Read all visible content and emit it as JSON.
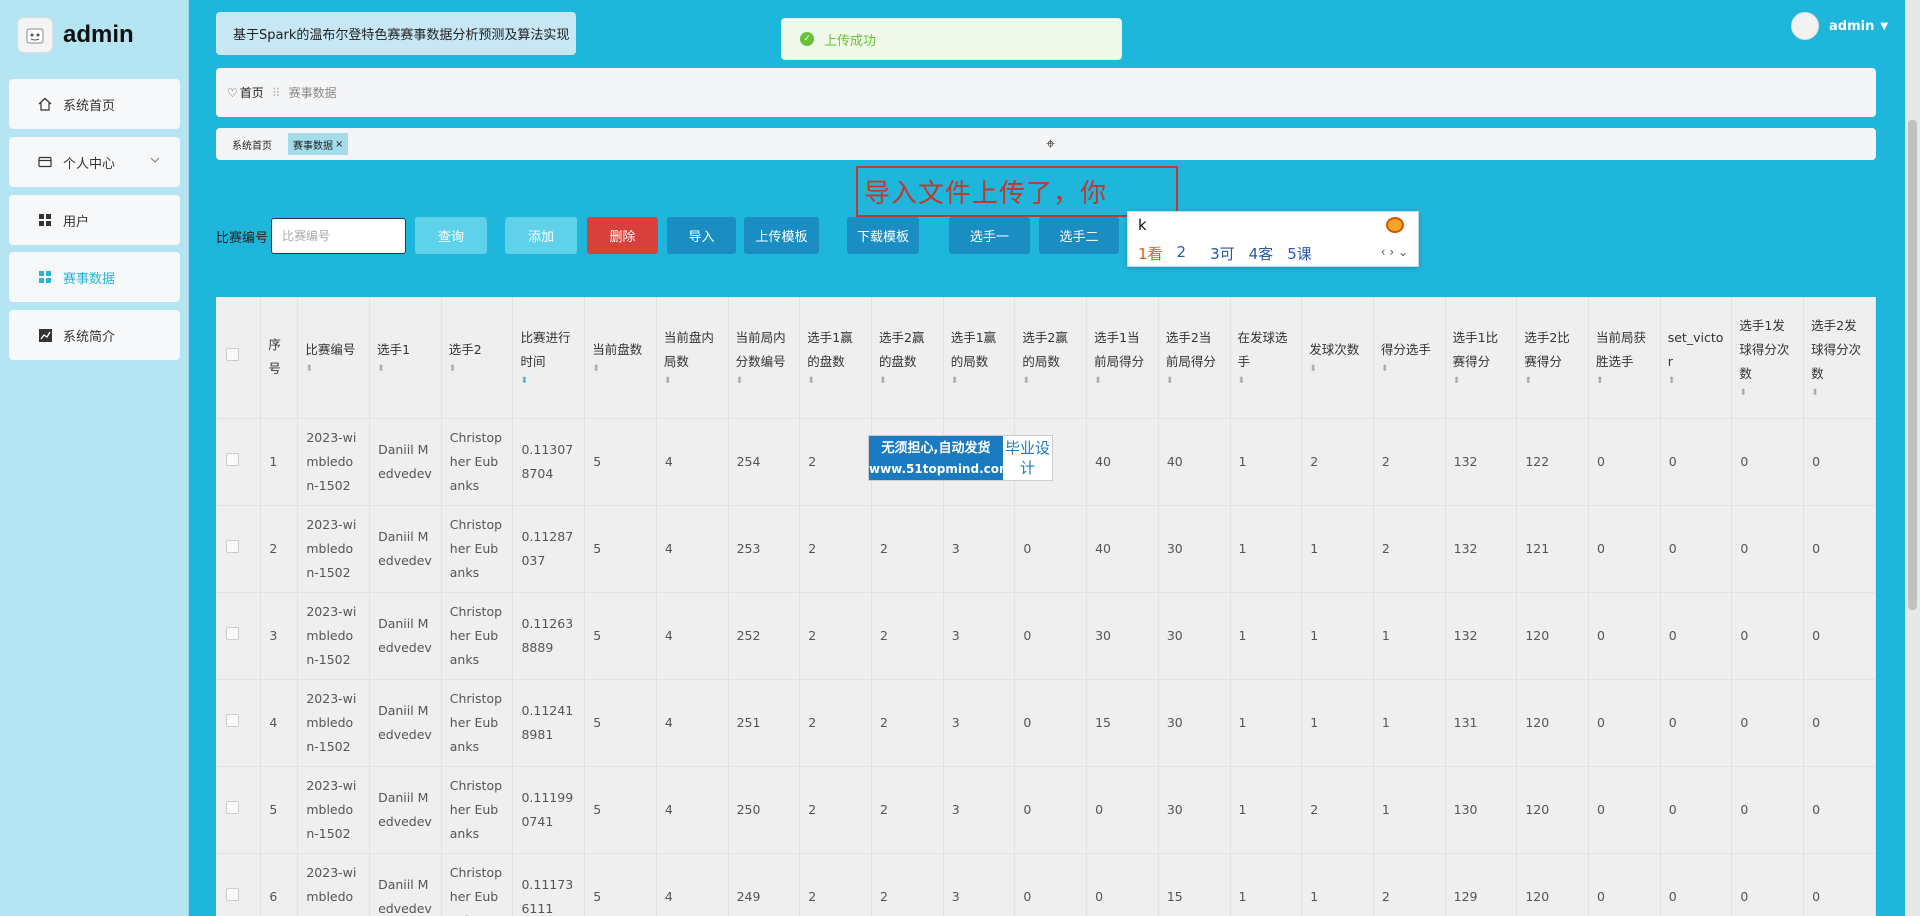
{
  "app": {
    "logo_text": "admin",
    "title": "基于Spark的温布尔登特色赛赛事数据分析预测及算法实现"
  },
  "toast": {
    "text": "上传成功"
  },
  "user": {
    "name": "admin"
  },
  "sidebar": {
    "items": [
      {
        "label": "系统首页",
        "icon": "home-icon"
      },
      {
        "label": "个人中心",
        "icon": "card-icon"
      },
      {
        "label": "用户",
        "icon": "grid-icon"
      },
      {
        "label": "赛事数据",
        "icon": "grid-icon"
      },
      {
        "label": "系统简介",
        "icon": "chart-icon"
      }
    ]
  },
  "breadcrumb": {
    "home": "首页",
    "current": "赛事数据"
  },
  "tabs": [
    {
      "label": "系统首页"
    },
    {
      "label": "赛事数据"
    }
  ],
  "annotation": "导入文件上传了，你",
  "ime": {
    "composition": "k",
    "candidates": [
      "1看",
      "2",
      "3可",
      "4客",
      "5课"
    ]
  },
  "search": {
    "label": "比赛编号",
    "placeholder": "比赛编号"
  },
  "toolbar": {
    "query": "查询",
    "add": "添加",
    "delete": "删除",
    "import": "导入",
    "upload_template": "上传模板",
    "download_template": "下载模板",
    "player1": "选手一",
    "player2": "选手二"
  },
  "watermark": {
    "line1": "无须担心,自动发货",
    "url": "www.51topmind.com",
    "right": "毕业设计"
  },
  "table": {
    "columns": [
      "序号",
      "比赛编号",
      "选手1",
      "选手2",
      "比赛进行时间",
      "当前盘数",
      "当前盘内局数",
      "当前局内分数编号",
      "选手1赢的盘数",
      "选手2赢的盘数",
      "选手1赢的局数",
      "选手2赢的局数",
      "选手1当前局得分",
      "选手2当前局得分",
      "在发球选手",
      "发球次数",
      "得分选手",
      "选手1比赛得分",
      "选手2比赛得分",
      "当前局获胜选手",
      "set_victor",
      "选手1发球得分次数",
      "选手2发球得分次数"
    ],
    "rows": [
      [
        "1",
        "2023-wimbledon-1502",
        "Daniil Medvedev",
        "Christopher Eubanks",
        "0.113078704",
        "5",
        "4",
        "254",
        "2",
        "",
        "",
        "",
        "40",
        "40",
        "1",
        "2",
        "2",
        "132",
        "122",
        "0",
        "0",
        "0",
        "0"
      ],
      [
        "2",
        "2023-wimbledon-1502",
        "Daniil Medvedev",
        "Christopher Eubanks",
        "0.11287037",
        "5",
        "4",
        "253",
        "2",
        "2",
        "3",
        "0",
        "40",
        "30",
        "1",
        "1",
        "2",
        "132",
        "121",
        "0",
        "0",
        "0",
        "0"
      ],
      [
        "3",
        "2023-wimbledon-1502",
        "Daniil Medvedev",
        "Christopher Eubanks",
        "0.112638889",
        "5",
        "4",
        "252",
        "2",
        "2",
        "3",
        "0",
        "30",
        "30",
        "1",
        "1",
        "1",
        "132",
        "120",
        "0",
        "0",
        "0",
        "0"
      ],
      [
        "4",
        "2023-wimbledon-1502",
        "Daniil Medvedev",
        "Christopher Eubanks",
        "0.112418981",
        "5",
        "4",
        "251",
        "2",
        "2",
        "3",
        "0",
        "15",
        "30",
        "1",
        "1",
        "1",
        "131",
        "120",
        "0",
        "0",
        "0",
        "0"
      ],
      [
        "5",
        "2023-wimbledon-1502",
        "Daniil Medvedev",
        "Christopher Eubanks",
        "0.111990741",
        "5",
        "4",
        "250",
        "2",
        "2",
        "3",
        "0",
        "0",
        "30",
        "1",
        "2",
        "1",
        "130",
        "120",
        "0",
        "0",
        "0",
        "0"
      ],
      [
        "6",
        "2023-wimbledon-1502",
        "Daniil Medvedev",
        "Christopher Eubanks",
        "0.111736111",
        "5",
        "4",
        "249",
        "2",
        "2",
        "3",
        "0",
        "0",
        "15",
        "1",
        "1",
        "2",
        "129",
        "120",
        "0",
        "0",
        "0",
        "0"
      ]
    ]
  }
}
